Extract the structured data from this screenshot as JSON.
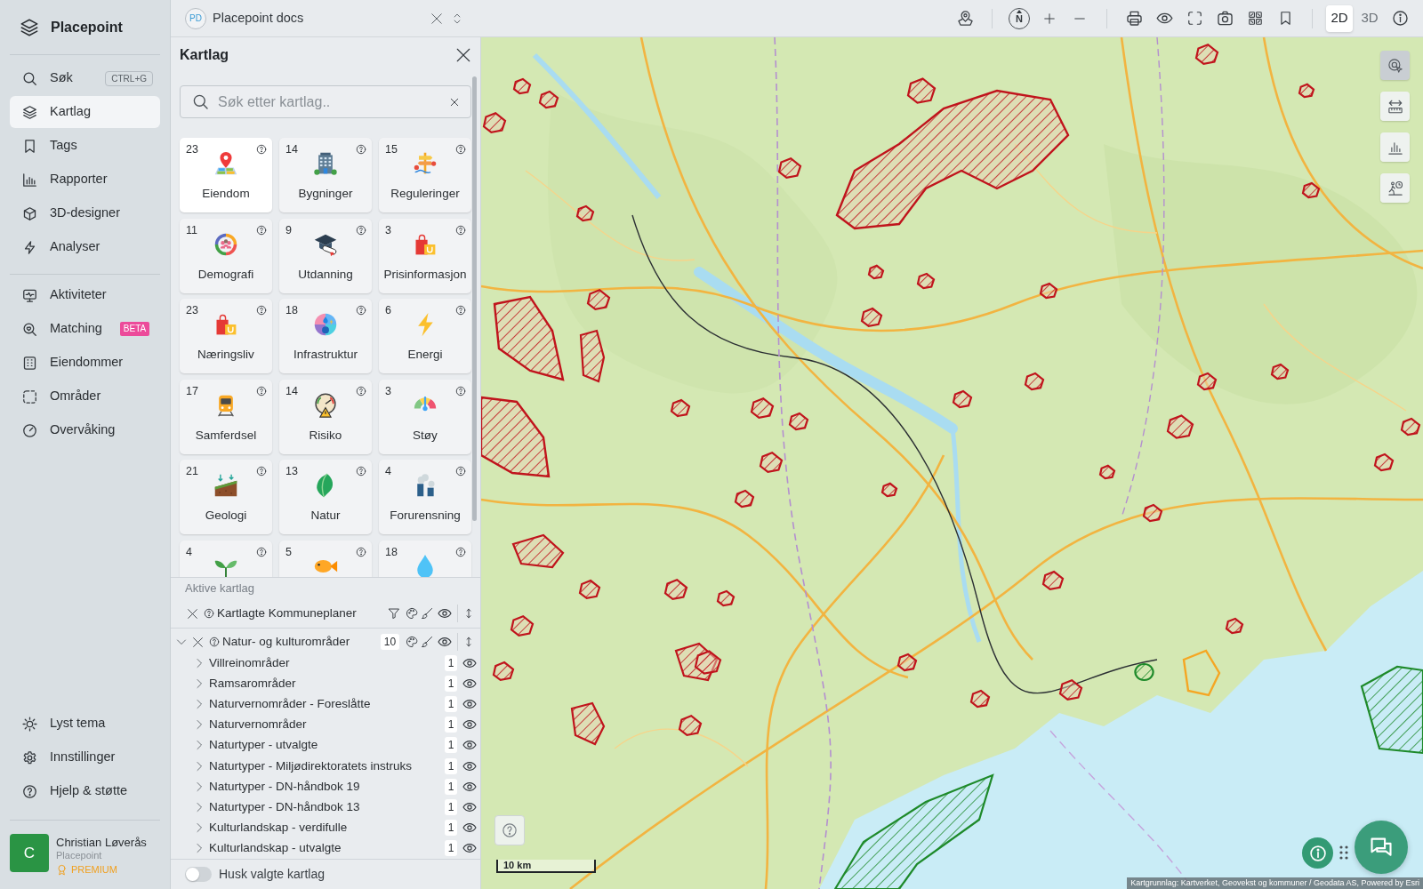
{
  "sidebar": {
    "logo": "Placepoint",
    "nav_groups": [
      {
        "items": [
          {
            "label": "Søk",
            "shortcut": "CTRL+G",
            "selected": false
          },
          {
            "label": "Kartlag",
            "selected": true
          },
          {
            "label": "Tags",
            "selected": false
          },
          {
            "label": "Rapporter",
            "selected": false
          },
          {
            "label": "3D-designer",
            "selected": false
          },
          {
            "label": "Analyser",
            "selected": false
          }
        ]
      },
      {
        "items": [
          {
            "label": "Aktiviteter",
            "selected": false
          },
          {
            "label": "Matching",
            "badge": "BETA",
            "selected": false
          },
          {
            "label": "Eiendommer",
            "selected": false
          },
          {
            "label": "Områder",
            "selected": false
          },
          {
            "label": "Overvåking",
            "selected": false
          }
        ]
      }
    ],
    "footer_items": [
      {
        "label": "Lyst tema"
      },
      {
        "label": "Innstillinger"
      },
      {
        "label": "Hjelp & støtte"
      }
    ],
    "user": {
      "initial": "C",
      "name": "Christian Løverås",
      "organization": "Placepoint",
      "plan": "PREMIUM"
    }
  },
  "topbar": {
    "document": {
      "initials": "PD",
      "title": "Placepoint docs"
    },
    "compass": "N",
    "view_modes": [
      {
        "label": "2D",
        "selected": true
      },
      {
        "label": "3D",
        "selected": false
      }
    ]
  },
  "layer_panel": {
    "title": "Kartlag",
    "search": {
      "placeholder": "Søk etter kartlag.."
    },
    "categories": [
      {
        "count": "23",
        "label": "Eiendom",
        "selected": true
      },
      {
        "count": "14",
        "label": "Bygninger",
        "selected": false
      },
      {
        "count": "15",
        "label": "Reguleringer",
        "selected": false
      },
      {
        "count": "11",
        "label": "Demografi",
        "selected": false
      },
      {
        "count": "9",
        "label": "Utdanning",
        "selected": false
      },
      {
        "count": "3",
        "label": "Prisinformasjon",
        "selected": false
      },
      {
        "count": "23",
        "label": "Næringsliv",
        "selected": false
      },
      {
        "count": "18",
        "label": "Infrastruktur",
        "selected": false
      },
      {
        "count": "6",
        "label": "Energi",
        "selected": false
      },
      {
        "count": "17",
        "label": "Samferdsel",
        "selected": false
      },
      {
        "count": "14",
        "label": "Risiko",
        "selected": false
      },
      {
        "count": "3",
        "label": "Støy",
        "selected": false
      },
      {
        "count": "21",
        "label": "Geologi",
        "selected": false
      },
      {
        "count": "13",
        "label": "Natur",
        "selected": false
      },
      {
        "count": "4",
        "label": "Forurensning",
        "selected": false
      },
      {
        "count": "4",
        "selected": false
      },
      {
        "count": "5",
        "selected": false
      },
      {
        "count": "18",
        "selected": false
      }
    ],
    "active_title": "Aktive kartlag",
    "active_layers": [
      {
        "name": "Kartlagte Kommuneplaner",
        "filter": true
      },
      {
        "name": "Natur- og kulturområder",
        "count": "10",
        "expanded": true,
        "children": [
          {
            "name": "Villreinområder",
            "count": "1",
            "expanded": false
          },
          {
            "name": "Ramsarområder",
            "count": "1",
            "expanded": false
          },
          {
            "name": "Naturvernområder - Foreslåtte",
            "count": "1",
            "expanded": false
          },
          {
            "name": "Naturvernområder",
            "count": "1",
            "expanded": false
          },
          {
            "name": "Naturtyper - utvalgte",
            "count": "1",
            "expanded": false
          },
          {
            "name": "Naturtyper - Miljødirektoratets instruks",
            "count": "1",
            "expanded": false
          },
          {
            "name": "Naturtyper - DN-håndbok 19",
            "count": "1",
            "expanded": false
          },
          {
            "name": "Naturtyper - DN-håndbok 13",
            "count": "1",
            "expanded": false
          },
          {
            "name": "Kulturlandskap - verdifulle",
            "count": "1",
            "expanded": false
          },
          {
            "name": "Kulturlandskap - utvalgte",
            "count": "1",
            "expanded": false
          }
        ]
      }
    ],
    "remember": {
      "label": "Husk valgte kartlag",
      "on": false
    }
  },
  "map": {
    "tools": [
      {
        "selected": true
      },
      {
        "selected": false
      },
      {
        "selected": false
      },
      {
        "selected": false
      }
    ],
    "scale": "10 km",
    "attribution": "Kartgrunnlag: Kartverket, Geovekst og kommuner / Geodata AS, Powered by Esri"
  }
}
